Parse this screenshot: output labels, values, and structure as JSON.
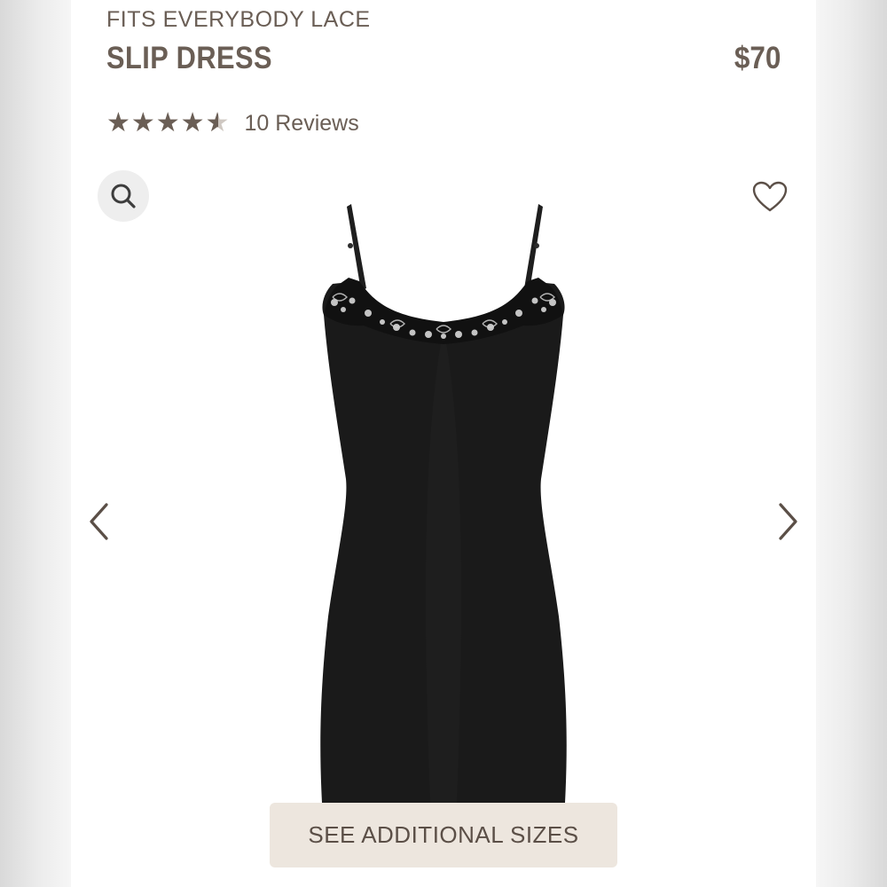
{
  "product": {
    "collection": "FITS EVERYBODY LACE",
    "name": "SLIP DRESS",
    "price": "$70"
  },
  "rating": {
    "value": 4.5,
    "max": 5,
    "stars_glyphs": "★★★★★",
    "reviews_label": "10 Reviews"
  },
  "actions": {
    "search_icon": "search-icon",
    "wishlist_icon": "heart-outline-icon",
    "prev_icon": "chevron-left-icon",
    "next_icon": "chevron-right-icon",
    "sizes_button_label": "SEE ADDITIONAL SIZES"
  },
  "colors": {
    "brand_text": "#6a5e55",
    "button_bg": "#ede6de",
    "product_color": "#1a1a1a"
  }
}
